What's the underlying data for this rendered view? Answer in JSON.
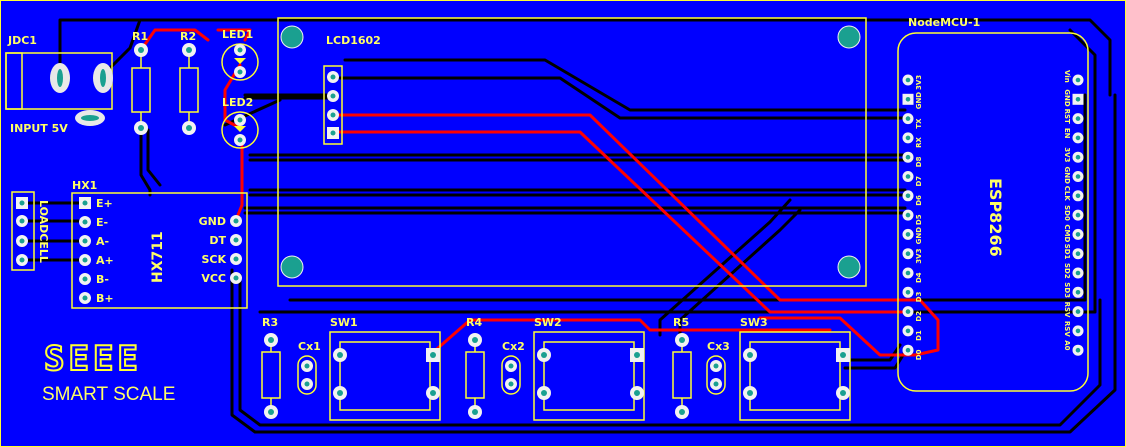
{
  "board": {
    "bg_color": "#0000ff",
    "silk_color": "#ffff33",
    "trace_color": "#000000",
    "top_trace_color": "#ff0000"
  },
  "labels": {
    "jdc1": "JDC1",
    "input": "INPUT 5V",
    "r1": "R1",
    "r2": "R2",
    "led1": "LED1",
    "led2": "LED2",
    "lcd": "LCD1602",
    "nodemcu": "NodeMCU-1",
    "hx1": "HX1",
    "loadcell": "LOADCELL",
    "hx711": "HX711",
    "r3": "R3",
    "r4": "R4",
    "r5": "R5",
    "cx1": "Cx1",
    "cx2": "Cx2",
    "cx3": "Cx3",
    "sw1": "SW1",
    "sw2": "SW2",
    "sw3": "SW3",
    "esp": "ESP8266",
    "logo": "SEEE",
    "brand": "SMART SCALE"
  },
  "hx_left_pins": [
    "E+",
    "E-",
    "A-",
    "A+",
    "B-",
    "B+"
  ],
  "hx_right_pins": [
    "GND",
    "DT",
    "SCK",
    "VCC"
  ],
  "mcu_left_pins": [
    "3V3",
    "GND",
    "TX",
    "RX",
    "D8",
    "D7",
    "D6",
    "D5",
    "GND",
    "3V3",
    "D4",
    "D3",
    "D2",
    "D1",
    "D0"
  ],
  "mcu_right_pins": [
    "Vin",
    "GND",
    "RST",
    "EN",
    "3V3",
    "GND",
    "CLK",
    "SD0",
    "CMD",
    "SD1",
    "SD2",
    "SD3",
    "RSV",
    "RSV",
    "A0"
  ]
}
